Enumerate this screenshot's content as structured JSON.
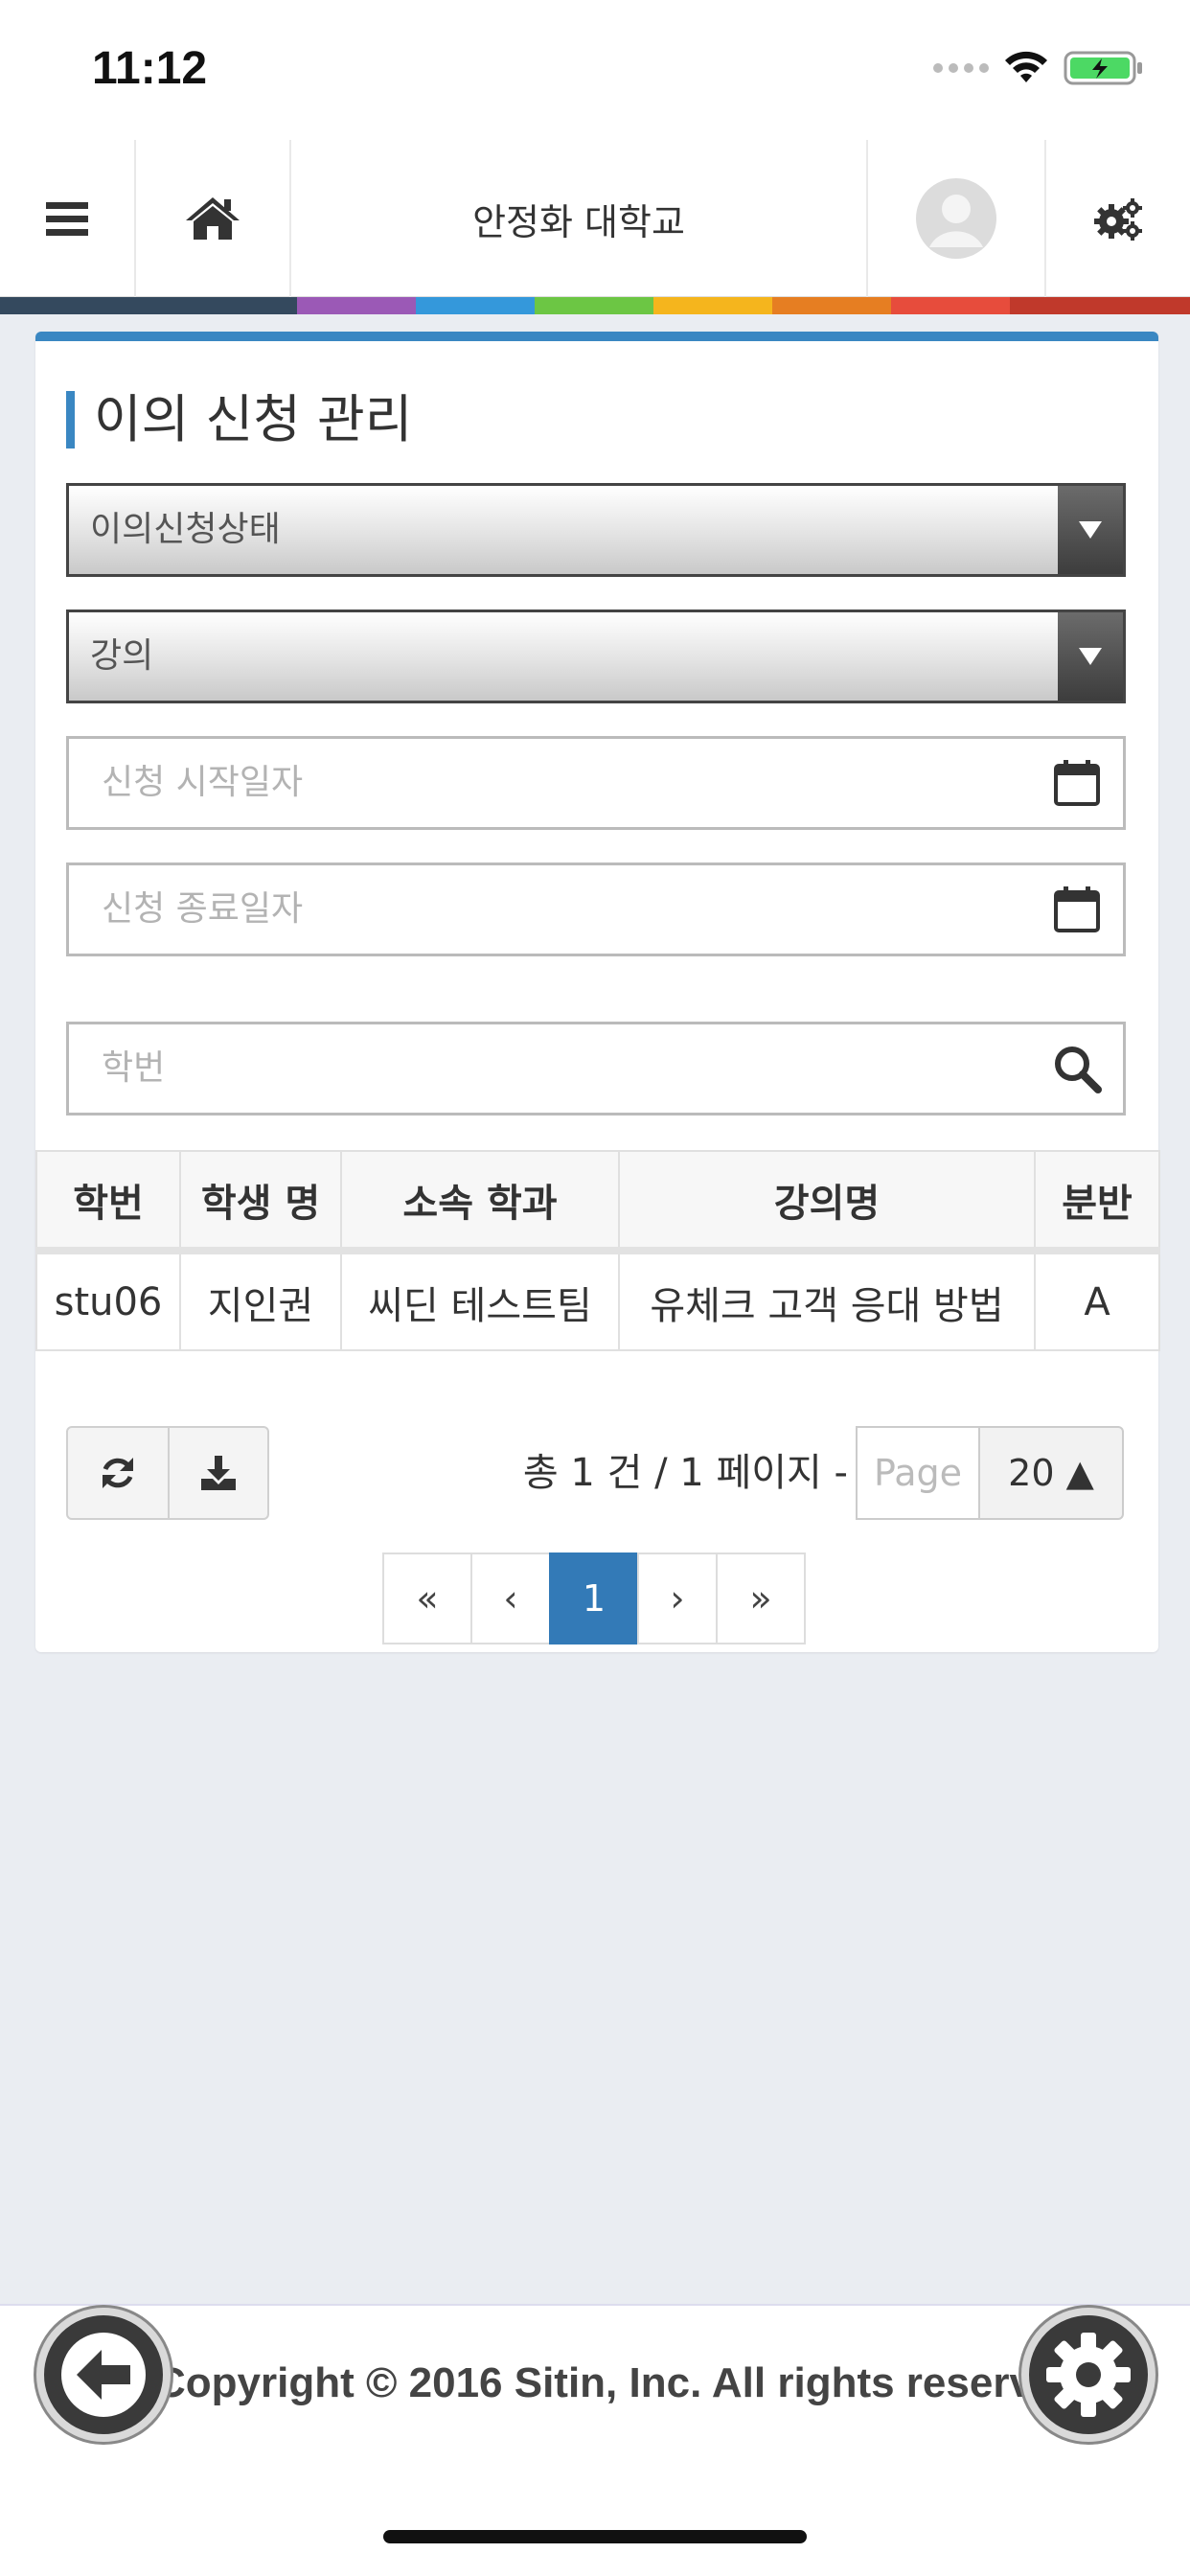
{
  "status_bar": {
    "time": "11:12"
  },
  "header": {
    "title": "안정화 대학교",
    "menu_icon": "hamburger-icon",
    "home_icon": "home-icon",
    "avatar_icon": "user-avatar-icon",
    "settings_icon": "gears-icon"
  },
  "color_strip": [
    "#34495e",
    "#9b59b6",
    "#3498db",
    "#6cc644",
    "#f5b51d",
    "#e67e22",
    "#e74c3c",
    "#c0392b"
  ],
  "page": {
    "title": "이의 신청 관리",
    "status_select": "이의신청상태",
    "lecture_select": "강의",
    "start_date_placeholder": "신청 시작일자",
    "end_date_placeholder": "신청 종료일자",
    "student_id_placeholder": "학번"
  },
  "table": {
    "headers": [
      "학번",
      "학생 명",
      "소속 학과",
      "강의명",
      "분반"
    ],
    "rows": [
      [
        "stu06",
        "지인권",
        "씨딘 테스트팀",
        "유체크 고객 응대 방법",
        "A"
      ]
    ]
  },
  "pagination": {
    "info": "총 1 건 / 1 페이지 -",
    "page_placeholder": "Page",
    "page_size": "20 ▲",
    "first": "«",
    "prev": "‹",
    "current": "1",
    "next": "›",
    "last": "»"
  },
  "footer": {
    "copyright": "Copyright © 2016 Sitin, Inc. All rights reserved."
  }
}
